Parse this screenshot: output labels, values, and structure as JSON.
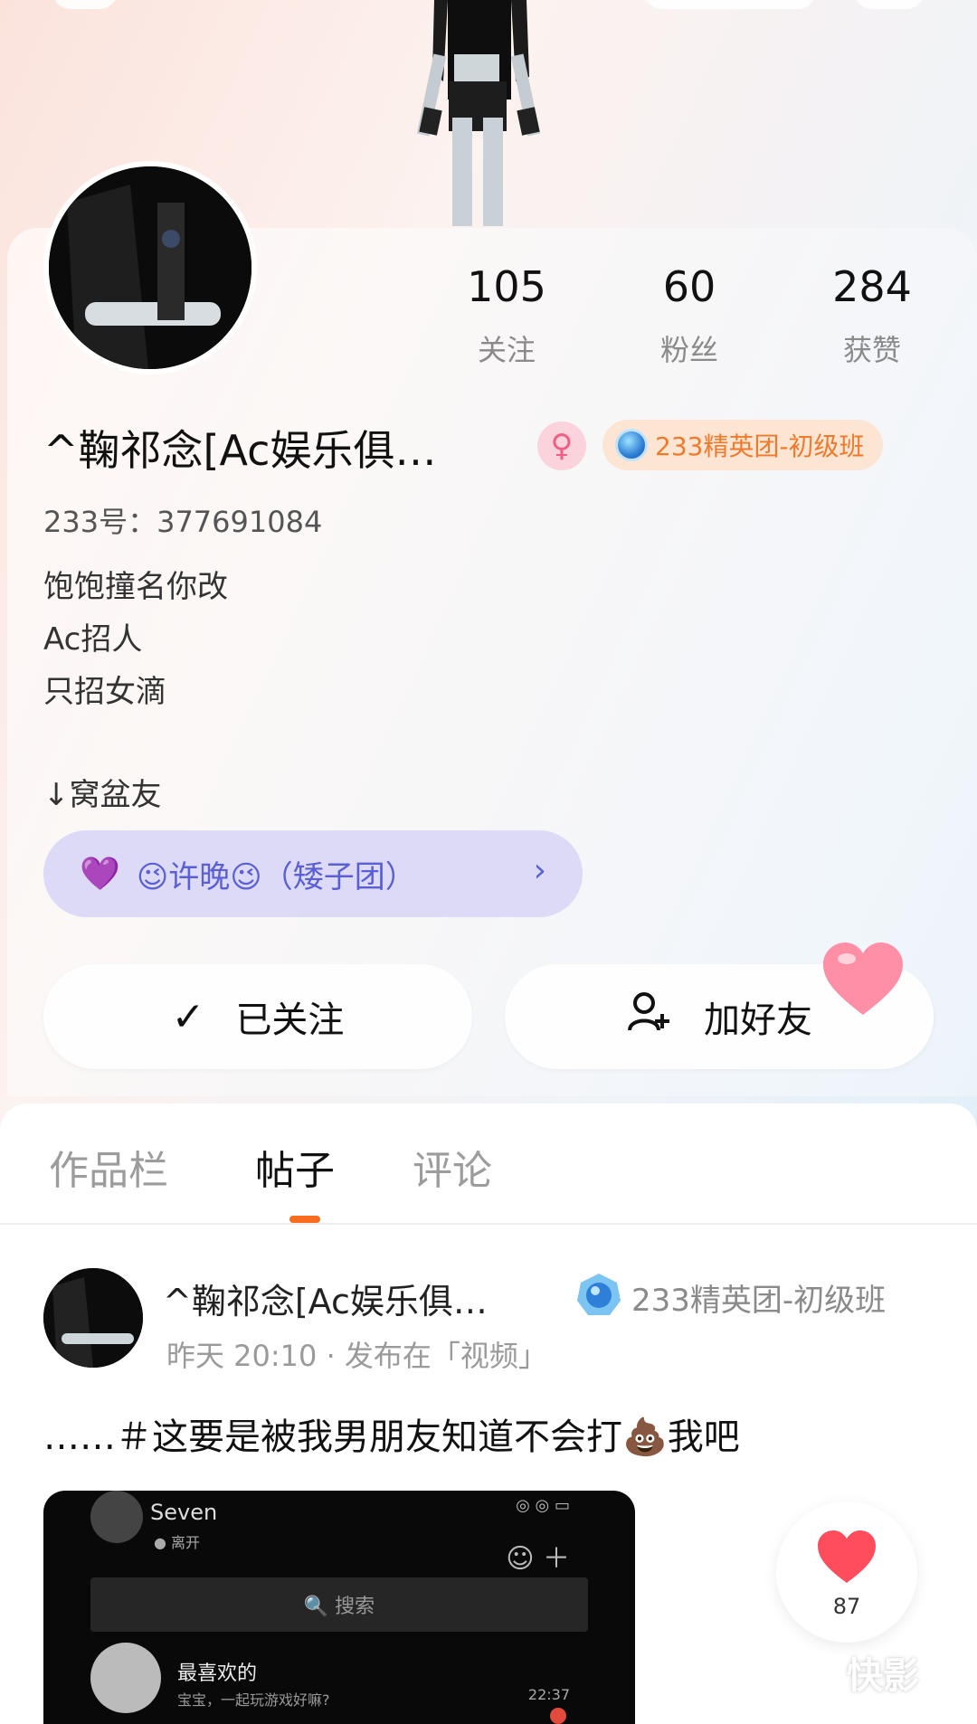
{
  "profile": {
    "stats": [
      {
        "value": "105",
        "label": "关注"
      },
      {
        "value": "60",
        "label": "粉丝"
      },
      {
        "value": "284",
        "label": "获赞"
      }
    ],
    "nickname": "^鞠祁念[Ac娱乐俱…",
    "gender_icon": "female-symbol",
    "badge": "233精英团-初级班",
    "uid": "233号：377691084",
    "bio": [
      "饱饱撞名你改",
      "Ac招人",
      "只招女滴",
      "↓窝盆友"
    ],
    "group_link": "😉许晚😉（矮子团）",
    "buttons": {
      "followed": "已关注",
      "add_friend": "加好友"
    }
  },
  "tabs": [
    {
      "label": "作品栏",
      "active": false
    },
    {
      "label": "帖子",
      "active": true
    },
    {
      "label": "评论",
      "active": false
    }
  ],
  "post": {
    "author": "^鞠祁念[Ac娱乐俱…",
    "badge": "233精英团-初级班",
    "meta": "昨天 20:10 · 发布在「视频」",
    "text": "……＃这要是被我男朋友知道不会打💩我吧",
    "like_count": "87",
    "screenshot": {
      "name": "Seven",
      "status": "● 离开",
      "search": "🔍 搜索",
      "row_name": "最喜欢的",
      "row_msg": "宝宝，一起玩游戏好嘛?",
      "row_time": "22:37"
    }
  },
  "watermark": "快影",
  "colors": {
    "accent": "#f96d1e",
    "badge_text": "#f07a2c",
    "group_text": "#5b5fd6",
    "heart": "#ff4d5e"
  }
}
